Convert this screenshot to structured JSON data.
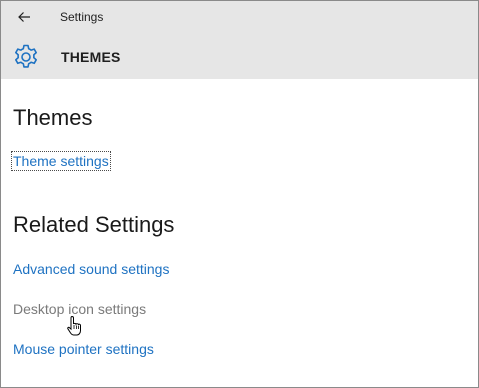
{
  "window": {
    "title": "Settings",
    "back_icon": "back-arrow-icon"
  },
  "header": {
    "icon": "gear-icon",
    "section_title": "THEMES"
  },
  "themes": {
    "heading": "Themes",
    "theme_settings_link": "Theme settings"
  },
  "related": {
    "heading": "Related Settings",
    "links": [
      "Advanced sound settings",
      "Desktop icon settings",
      "Mouse pointer settings"
    ]
  },
  "colors": {
    "accent": "#1e72c2",
    "header_bg": "#e6e6e6",
    "hover_text": "#7a7a7a"
  }
}
